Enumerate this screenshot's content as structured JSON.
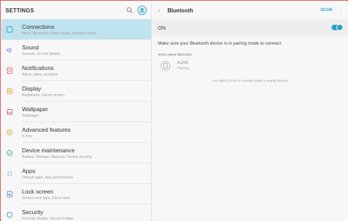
{
  "left": {
    "title": "SETTINGS",
    "search_icon": "search-icon",
    "account_icon": "account-icon",
    "items": [
      {
        "title": "Connections",
        "subtitle": "Wi-Fi, Bluetooth, Data usage, Airplane mode",
        "icon": "connections-icon",
        "selected": true
      },
      {
        "title": "Sound",
        "subtitle": "Sounds, Do not disturb",
        "icon": "sound-icon"
      },
      {
        "title": "Notifications",
        "subtitle": "Block, allow, prioritize",
        "icon": "notifications-icon"
      },
      {
        "title": "Display",
        "subtitle": "Brightness, Home screen",
        "icon": "display-icon"
      },
      {
        "title": "Wallpaper",
        "subtitle": "Wallpaper",
        "icon": "wallpaper-icon"
      },
      {
        "title": "Advanced features",
        "subtitle": "S Pen",
        "icon": "advanced-features-icon"
      },
      {
        "title": "Device maintenance",
        "subtitle": "Battery, Storage, Memory, Device security",
        "icon": "device-maintenance-icon"
      },
      {
        "title": "Apps",
        "subtitle": "Default apps, App permissions",
        "icon": "apps-icon"
      },
      {
        "title": "Lock screen",
        "subtitle": "Screen lock type, Clock style",
        "icon": "lock-screen-icon"
      },
      {
        "title": "Security",
        "subtitle": "Find My Mobile, Secure Folder",
        "icon": "security-icon"
      }
    ]
  },
  "right": {
    "title": "Bluetooth",
    "scan_label": "SCAN",
    "on_label": "ON",
    "toggle_on": true,
    "hint": "Make sure your Bluetooth device is in pairing mode to connect.",
    "section_label": "AVAILABLE DEVICES",
    "device": {
      "name": "AJAX",
      "status": "Pairing..."
    },
    "visible_note": "Your tablet (AJAX) is currently visible to nearby devices."
  },
  "colors": {
    "accent": "#2aa1c8",
    "selected_bg": "#bfe3ef",
    "frame_border": "#d9534f"
  }
}
